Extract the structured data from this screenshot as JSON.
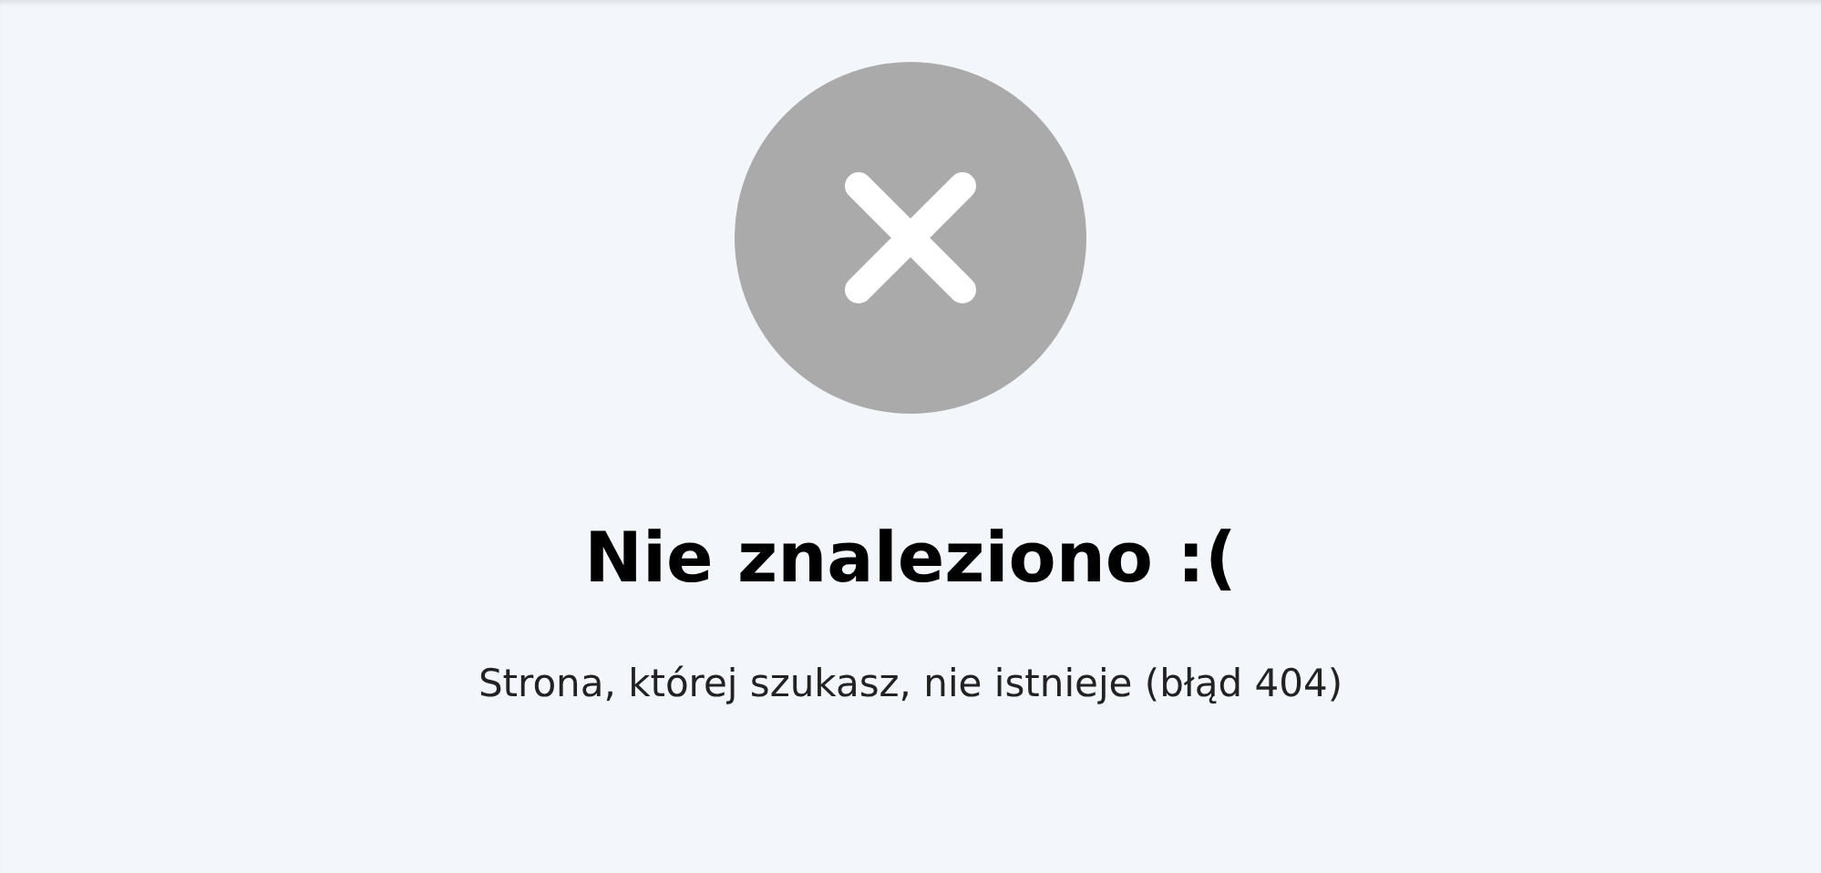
{
  "title": "Nie znaleziono :(",
  "message": "Strona, której szukasz, nie istnieje (błąd 404)"
}
